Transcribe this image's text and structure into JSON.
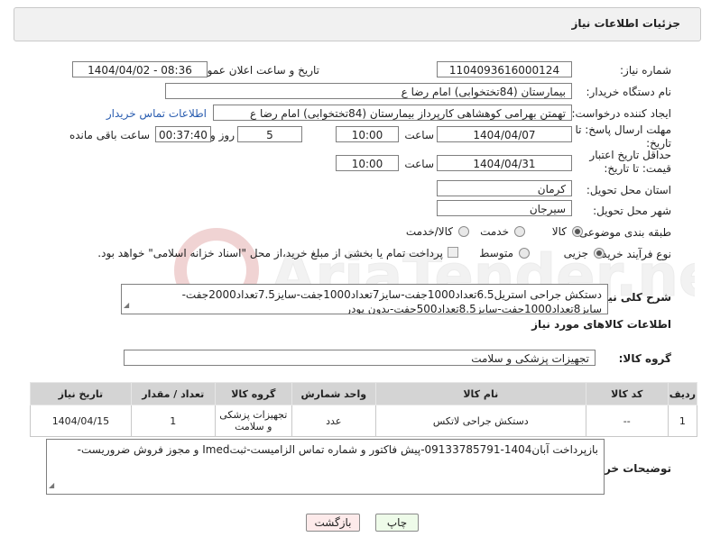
{
  "header": {
    "title": "جزئیات اطلاعات نیاز"
  },
  "form": {
    "need_number_label": "شماره نیاز:",
    "need_number": "1104093616000124",
    "announce_label": "تاریخ و ساعت اعلان عمومی:",
    "announce_value": "1404/04/02 - 08:36",
    "buyer_org_label": "نام دستگاه خریدار:",
    "buyer_org": "بیمارستان (84تختخوابی) امام رضا  ع",
    "creator_label": "ایجاد کننده درخواست:",
    "creator": "تهمتن بهرامی کوهشاهی کارپرداز بیمارستان (84تختخوابی) امام رضا  ع",
    "contact_link": "اطلاعات تماس خریدار",
    "deadline_label": "مهلت ارسال پاسخ: تا تاریخ:",
    "deadline_date": "1404/04/07",
    "time_label": "ساعت",
    "deadline_time": "10:00",
    "days_value": "5",
    "days_label": "روز و",
    "remaining_time": "00:37:40",
    "remaining_label": "ساعت باقی مانده",
    "min_price_label": "حداقل تاریخ اعتبار قیمت: تا تاریخ:",
    "min_price_date": "1404/04/31",
    "min_price_time": "10:00",
    "province_label": "استان محل تحویل:",
    "province": "کرمان",
    "city_label": "شهر محل تحویل:",
    "city": "سیرجان",
    "category_label": "طبقه بندی موضوعی:",
    "category_options": [
      "کالا",
      "خدمت",
      "کالا/خدمت"
    ],
    "process_label": "نوع فرآیند خرید :",
    "process_options": [
      "جزیی",
      "متوسط"
    ],
    "payment_note": "پرداخت تمام یا بخشی از مبلغ خرید،از محل \"اسناد خزانه اسلامی\" خواهد بود."
  },
  "description": {
    "label": "شرح کلی نیاز:",
    "text": "دستکش جراحی استریل6.5تعداد1000جفت-سایز7تعداد1000جفت-سایز7.5تعداد2000جفت-سایز8تعداد1000جفت-سایز8.5تعداد500جفت-بدون پودر"
  },
  "goods_info": {
    "heading": "اطلاعات کالاهای مورد نیاز",
    "group_label": "گروه کالا:",
    "group_value": "تجهیزات پزشکی و سلامت"
  },
  "table": {
    "headers": [
      "ردیف",
      "کد کالا",
      "نام کالا",
      "واحد شمارش",
      "گروه کالا",
      "تعداد / مقدار",
      "تاریخ نیاز"
    ],
    "rows": [
      [
        "1",
        "--",
        "دستکش جراحی لاتکس",
        "عدد",
        "تجهیزات پزشکی و سلامت",
        "1",
        "1404/04/15"
      ]
    ]
  },
  "buyer_notes": {
    "label": "توضیحات خریدار:",
    "text": "بازپرداخت آبان1404-09133785791-پیش فاکتور و شماره تماس الزامیست-ثبتImed و مجوز فروش ضروریست-"
  },
  "buttons": {
    "print": "چاپ",
    "back": "بازگشت"
  },
  "colors": {
    "link": "#2a5db0",
    "print_bg": "#eefbe9",
    "back_bg": "#fdeaea",
    "table_header": "#d4d4d4"
  }
}
